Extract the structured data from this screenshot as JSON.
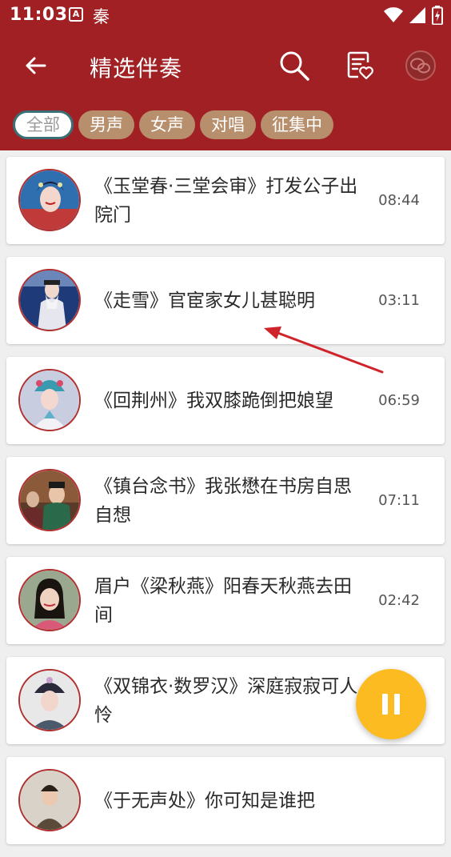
{
  "status_bar": {
    "time": "11:03",
    "a_icon_letter": "A",
    "app_name": "秦"
  },
  "toolbar": {
    "title": "精选伴奏"
  },
  "tabs": [
    {
      "label": "全部",
      "active": true
    },
    {
      "label": "男声",
      "active": false
    },
    {
      "label": "女声",
      "active": false
    },
    {
      "label": "对唱",
      "active": false
    },
    {
      "label": "征集中",
      "active": false
    }
  ],
  "songs": [
    {
      "title": "《玉堂春·三堂会审》打发公子出院门",
      "duration": "08:44"
    },
    {
      "title": "《走雪》官宦家女儿甚聪明",
      "duration": "03:11"
    },
    {
      "title": "《回荆州》我双膝跪倒把娘望",
      "duration": "06:59"
    },
    {
      "title": "《镇台念书》我张懋在书房自思自想",
      "duration": "07:11"
    },
    {
      "title": "眉户《梁秋燕》阳春天秋燕去田间",
      "duration": "02:42"
    },
    {
      "title": "《双锦衣·数罗汉》深庭寂寂可人怜",
      "duration": ""
    },
    {
      "title": "《于无声处》你可知是谁把",
      "duration": ""
    }
  ],
  "colors": {
    "header": "#a02024",
    "tab": "#b88f6d",
    "tab_active_border": "#3b6f77",
    "fab": "#fbbb21",
    "annotation_arrow": "#d0242b"
  }
}
